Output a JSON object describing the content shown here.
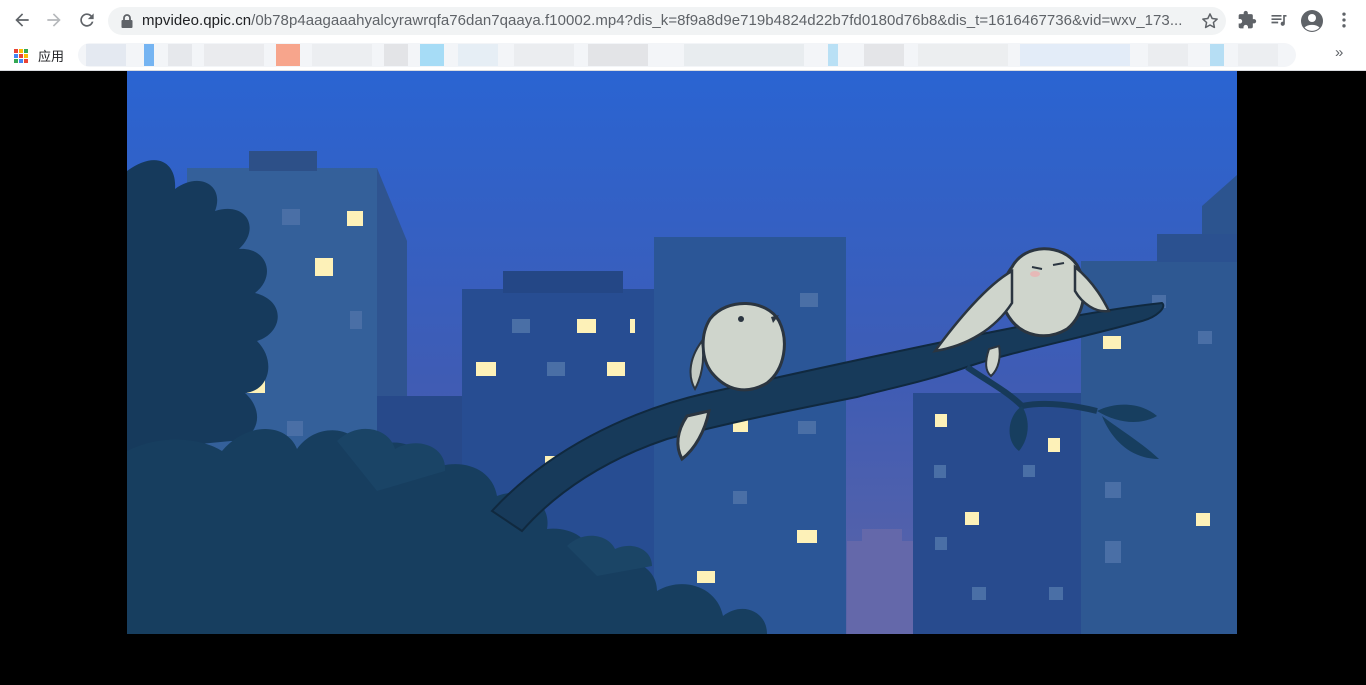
{
  "toolbar": {
    "url_host": "mpvideo.qpic.cn",
    "url_path": "/0b78p4aagaaahyalcyrawrqfa76dan7qaaya.f10002.mp4?dis_k=8f9a8d9e719b4824d22b7fd0180d76b8&dis_t=1616467736&vid=wxv_173...",
    "icons": [
      "back-icon",
      "forward-icon",
      "reload-icon",
      "lock-icon",
      "star-icon",
      "extensions-icon",
      "media-control-icon",
      "profile-icon",
      "menu-icon"
    ]
  },
  "bookmarks": {
    "apps_label": "应用",
    "more_label": "»"
  },
  "colors": {
    "sky_top": "#2a62cc",
    "sky_bottom": "#5663ad",
    "building": "#2e5591",
    "foliage": "#163a5c",
    "window_lit": "#fdf1b8",
    "bird": "#cfd5cc"
  }
}
